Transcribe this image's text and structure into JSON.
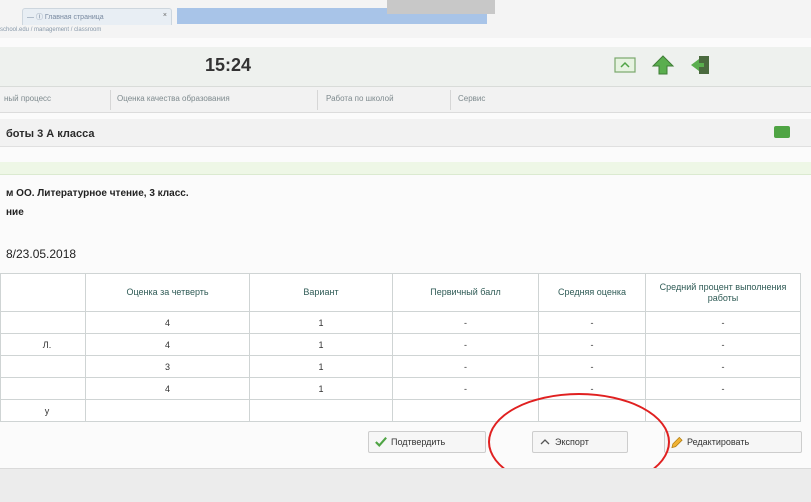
{
  "browser": {
    "tab_label": "— Ⓘ Главная страница",
    "tab_close": "×",
    "url_text": "school.edu / management / classroom"
  },
  "header": {
    "time": "15:24",
    "icons": [
      "screen-icon",
      "up-arrow-icon",
      "exit-icon"
    ]
  },
  "nav": {
    "items": [
      "ный процесс",
      "Оценка качества образования",
      "Работа по школой",
      "Сервис"
    ]
  },
  "title": {
    "text": "боты 3 А класса"
  },
  "info": {
    "line1": "м ОО. Литературное чтение, 3 класс.",
    "line2": "ние",
    "date": "8/23.05.2018"
  },
  "table": {
    "headers": [
      "",
      "Оценка за четверть",
      "Вариант",
      "Первичный балл",
      "Средняя оценка",
      "Средний процент выполнения работы"
    ],
    "rows": [
      [
        "",
        "4",
        "1",
        "-",
        "-",
        "-"
      ],
      [
        "Л.",
        "4",
        "1",
        "-",
        "-",
        "-"
      ],
      [
        "",
        "3",
        "1",
        "-",
        "-",
        "-"
      ],
      [
        "",
        "4",
        "1",
        "-",
        "-",
        "-"
      ],
      [
        "у",
        "",
        "",
        "",
        "",
        ""
      ]
    ]
  },
  "actions": {
    "confirm_label": "Подтвердить",
    "export_label": "Экспорт",
    "edit_label": "Редактировать"
  },
  "colors": {
    "accent_green": "#4fa444",
    "annotation_red": "#e02020",
    "header_text": "#2f5b56"
  }
}
